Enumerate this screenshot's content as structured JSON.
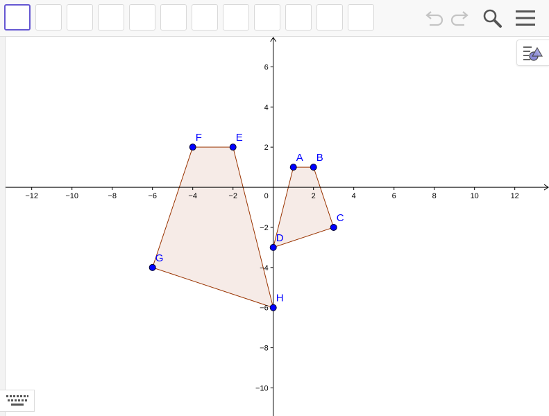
{
  "toolbar": {
    "tool_count": 12,
    "undo_icon": "undo-icon",
    "redo_icon": "redo-icon",
    "search_icon": "search-icon",
    "menu_icon": "hamburger-menu-icon"
  },
  "colors": {
    "accent": "#6557d2",
    "point": "#0000ff",
    "point_label": "#0000ff",
    "polygon_stroke": "#993300",
    "polygon_fill": "#f5e8e3",
    "axis": "#000000"
  },
  "axes": {
    "xmin": -13.3,
    "xmax": 13.7,
    "ymin": -11.4,
    "ymax": 7.5,
    "x_ticks": [
      -12,
      -10,
      -8,
      -6,
      -4,
      -2,
      2,
      4,
      6,
      8,
      10,
      12
    ],
    "y_ticks": [
      -10,
      -8,
      -6,
      -4,
      -2,
      2,
      4,
      6
    ],
    "origin_label": "0"
  },
  "points": [
    {
      "name": "A",
      "x": 1,
      "y": 1
    },
    {
      "name": "B",
      "x": 2,
      "y": 1
    },
    {
      "name": "C",
      "x": 3,
      "y": -2
    },
    {
      "name": "D",
      "x": 0,
      "y": -3
    },
    {
      "name": "E",
      "x": -2,
      "y": 2
    },
    {
      "name": "F",
      "x": -4,
      "y": 2
    },
    {
      "name": "G",
      "x": -6,
      "y": -4
    },
    {
      "name": "H",
      "x": 0,
      "y": -6
    }
  ],
  "polygons": [
    {
      "vertices": [
        "A",
        "B",
        "C",
        "D"
      ]
    },
    {
      "vertices": [
        "F",
        "E",
        "H",
        "G"
      ]
    }
  ],
  "style_bar_icon": "style-bar-icon",
  "keyboard_icon": "keyboard-icon"
}
